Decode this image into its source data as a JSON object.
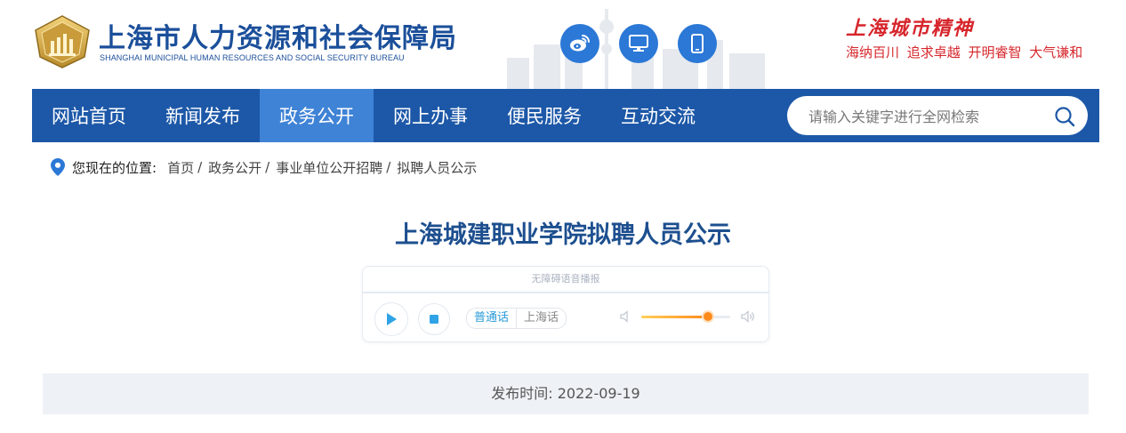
{
  "header": {
    "title_cn": "上海市人力资源和社会保障局",
    "title_en": "SHANGHAI MUNICIPAL HUMAN RESOURCES AND SOCIAL SECURITY BUREAU",
    "logo_icon": "bureau-emblem-icon",
    "social": [
      {
        "name": "weibo-icon"
      },
      {
        "name": "desktop-icon"
      },
      {
        "name": "mobile-icon"
      }
    ],
    "spirit_title": "上海城市精神",
    "spirit_words": "海纳百川 追求卓越 开明睿智 大气谦和"
  },
  "nav": {
    "items": [
      {
        "label": "网站首页"
      },
      {
        "label": "新闻发布"
      },
      {
        "label": "政务公开",
        "active": true
      },
      {
        "label": "网上办事"
      },
      {
        "label": "便民服务"
      },
      {
        "label": "互动交流"
      }
    ],
    "search_placeholder": "请输入关键字进行全网检索",
    "search_value": ""
  },
  "breadcrumb": {
    "label": "您现在的位置:",
    "items": [
      {
        "label": "首页"
      },
      {
        "label": "政务公开"
      },
      {
        "label": "事业单位公开招聘"
      },
      {
        "label": "拟聘人员公示"
      }
    ],
    "separator": "/"
  },
  "article": {
    "title": "上海城建职业学院拟聘人员公示",
    "publish": "发布时间: 2022-09-19"
  },
  "player": {
    "title": "无障碍语音播报",
    "languages": [
      "普通话",
      "上海话"
    ],
    "active_language": "普通话",
    "volume": 0.75
  },
  "colors": {
    "brand_blue": "#1d58a8",
    "nav_active": "#3f83d6",
    "spirit_red": "#d6262c",
    "title_blue": "#1d4f8f"
  }
}
